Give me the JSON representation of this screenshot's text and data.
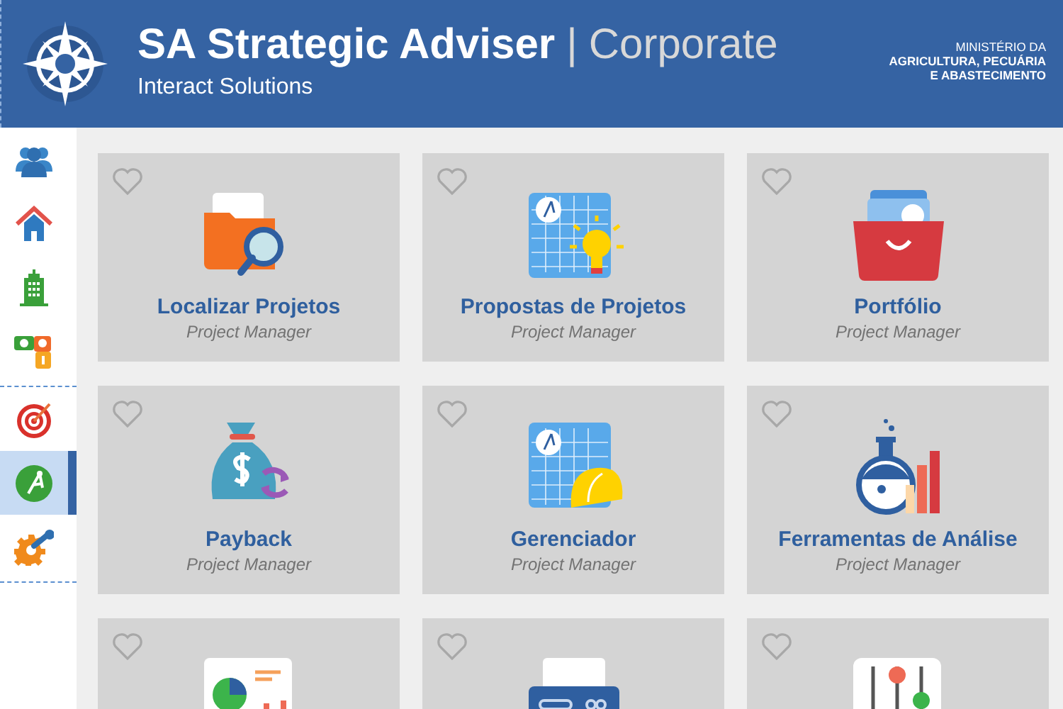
{
  "header": {
    "title": "SA Strategic Adviser",
    "separator": "|",
    "edition": "Corporate",
    "subtitle": "Interact Solutions",
    "ministry": [
      "MINISTÉRIO DA",
      "AGRICULTURA, PECUÁRIA",
      "E ABASTECIMENTO"
    ]
  },
  "sidebar": {
    "groups": [
      {
        "items": [
          {
            "selected": false
          },
          {
            "selected": false
          },
          {
            "selected": false
          },
          {
            "selected": false
          }
        ]
      },
      {
        "items": [
          {
            "selected": false
          },
          {
            "selected": true
          },
          {
            "selected": false
          }
        ]
      }
    ]
  },
  "cards": [
    {
      "title": "Localizar Projetos",
      "subtitle": "Project Manager",
      "favorite": false
    },
    {
      "title": "Propostas de Projetos",
      "subtitle": "Project Manager",
      "favorite": false
    },
    {
      "title": "Portfólio",
      "subtitle": "Project Manager",
      "favorite": false
    },
    {
      "title": "Payback",
      "subtitle": "Project Manager",
      "favorite": false
    },
    {
      "title": "Gerenciador",
      "subtitle": "Project Manager",
      "favorite": false
    },
    {
      "title": "Ferramentas de Análise",
      "subtitle": "Project Manager",
      "favorite": false
    },
    {
      "favorite": false
    },
    {
      "favorite": false
    },
    {
      "favorite": false
    }
  ]
}
